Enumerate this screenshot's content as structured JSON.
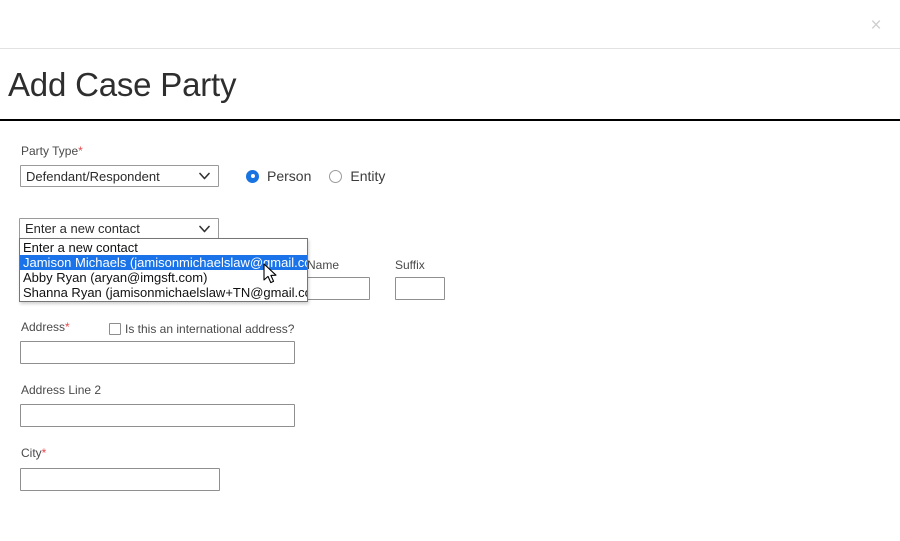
{
  "modal": {
    "close_label": "×",
    "title": "Add Case Party"
  },
  "form": {
    "party_type": {
      "label": "Party Type",
      "required_mark": "*",
      "value": "Defendant/Respondent",
      "options": [
        "Defendant/Respondent"
      ]
    },
    "person_entity": {
      "person_label": "Person",
      "entity_label": "Entity",
      "selected": "Person"
    },
    "contact": {
      "value": "Enter a new contact",
      "options": [
        "Enter a new contact",
        "Jamison Michaels (jamisonmichaelslaw@gmail.com)",
        "Abby Ryan (aryan@imgsft.com)",
        "Shanna Ryan (jamisonmichaelslaw+TN@gmail.com)"
      ],
      "highlighted_index": 1
    },
    "middle_name": {
      "label": "Name",
      "value": ""
    },
    "suffix": {
      "label": "Suffix",
      "value": ""
    },
    "address": {
      "label": "Address",
      "required_mark": "*",
      "value": ""
    },
    "international": {
      "label": "Is this an international address?",
      "checked": false
    },
    "address_line_2": {
      "label": "Address Line 2",
      "value": ""
    },
    "city": {
      "label": "City",
      "required_mark": "*",
      "value": ""
    }
  },
  "colors": {
    "required": "#e8474c",
    "accent": "#1874e0",
    "highlight": "#1a73e8",
    "rule": "#000000"
  }
}
